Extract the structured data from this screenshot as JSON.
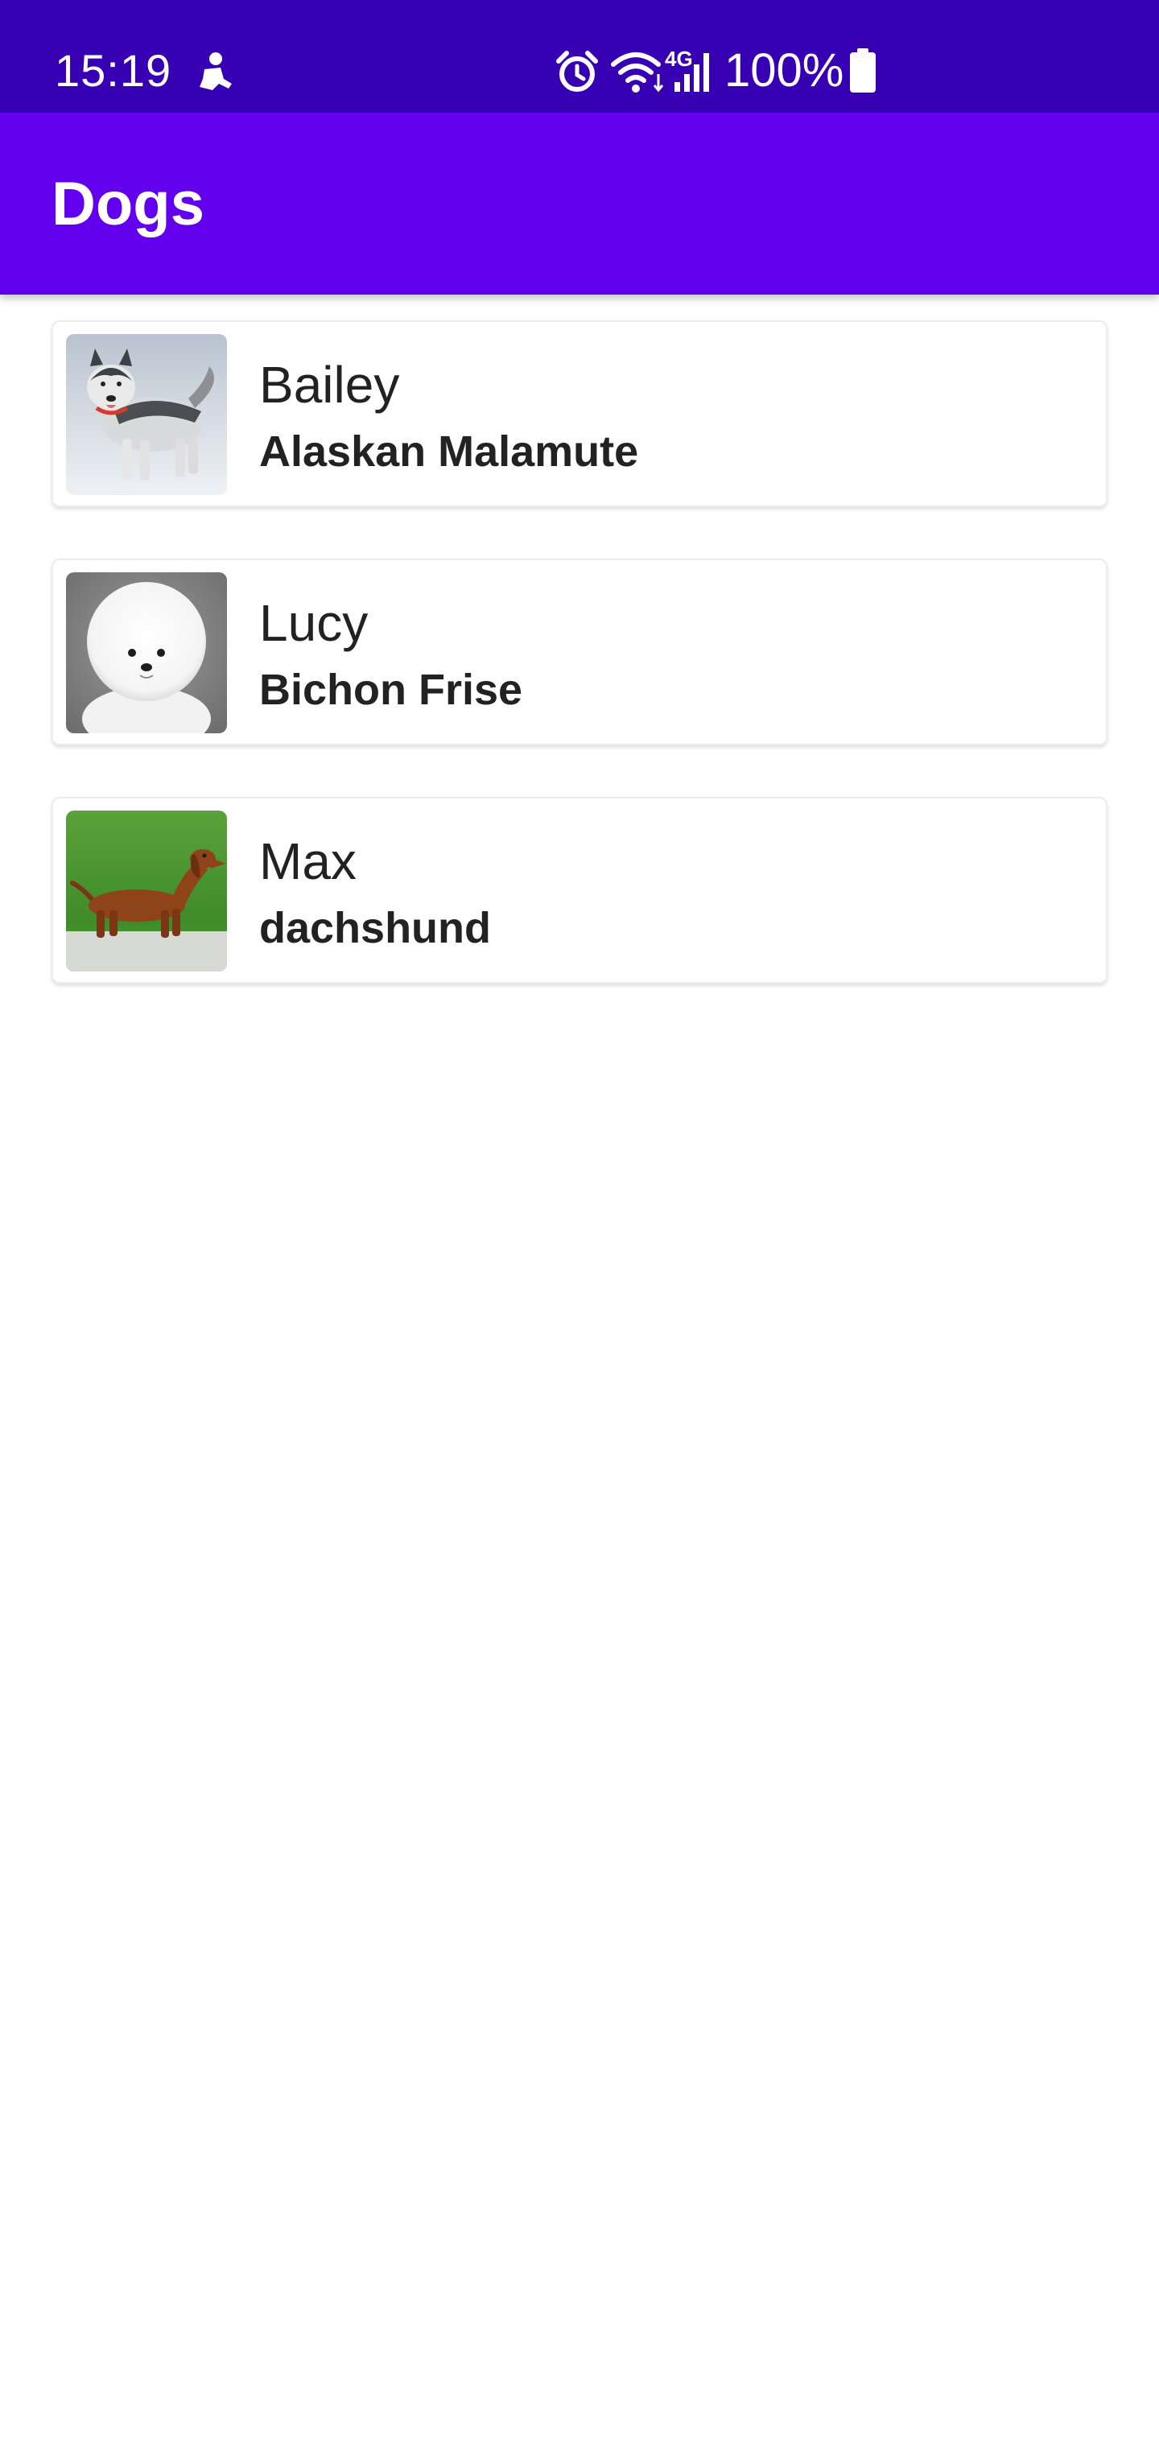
{
  "status_bar": {
    "time": "15:19",
    "battery": "100%",
    "network": "4G",
    "icons": [
      "notification-icon",
      "alarm-icon",
      "wifi-icon",
      "signal-icon",
      "battery-icon"
    ],
    "color": "#3700b3"
  },
  "app_bar": {
    "title": "Dogs",
    "color": "#6200ee"
  },
  "dogs": [
    {
      "name": "Bailey",
      "breed": "Alaskan Malamute"
    },
    {
      "name": "Lucy",
      "breed": "Bichon Frise"
    },
    {
      "name": "Max",
      "breed": "dachshund"
    }
  ]
}
